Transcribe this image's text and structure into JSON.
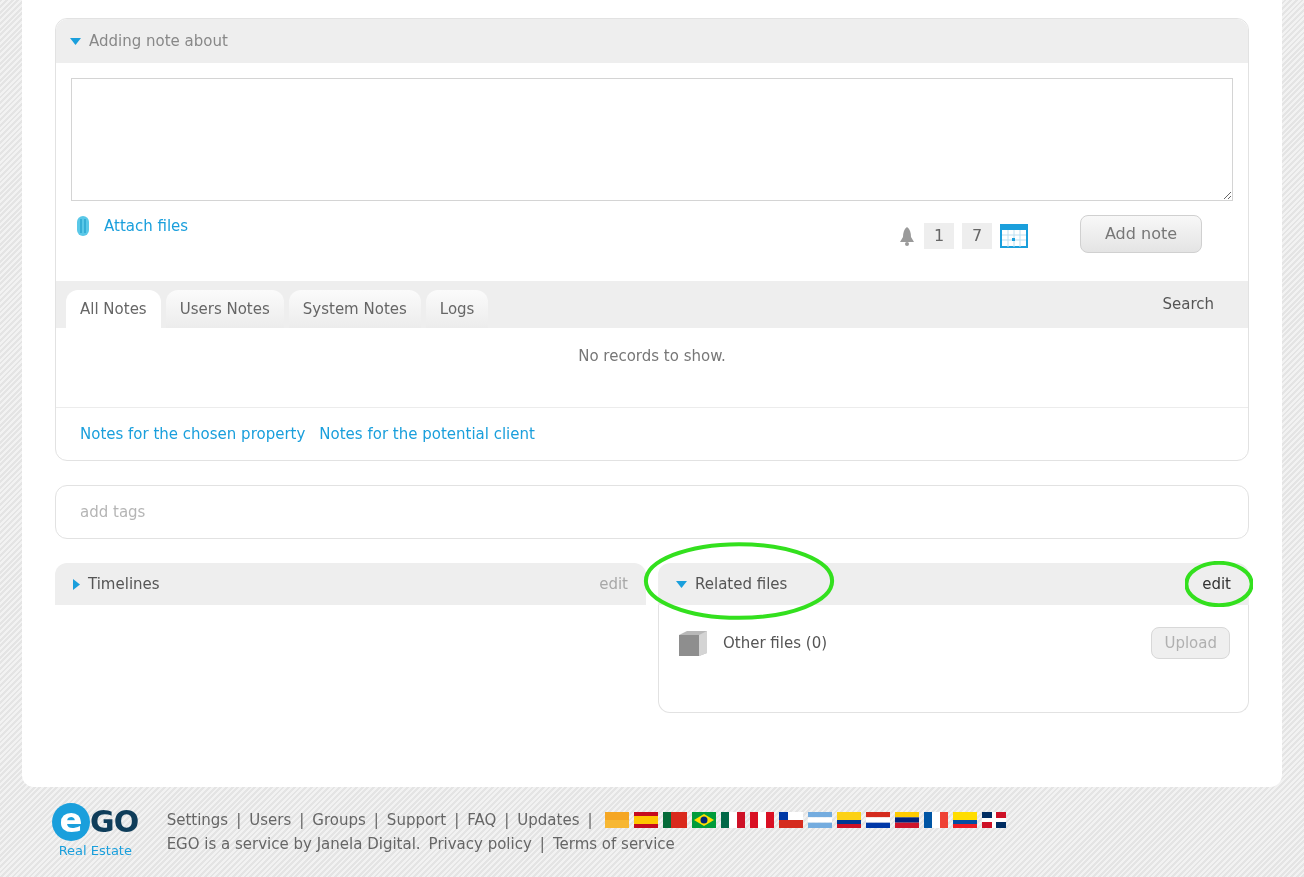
{
  "note_panel": {
    "title": "Adding note about",
    "expanded": true,
    "attach_label": "Attach files",
    "reminder": {
      "fields": [
        "1",
        "7"
      ]
    },
    "add_button": "Add note"
  },
  "tabs": [
    {
      "label": "All Notes",
      "selected": true
    },
    {
      "label": "Users Notes",
      "selected": false
    },
    {
      "label": "System Notes",
      "selected": false
    },
    {
      "label": "Logs",
      "selected": false
    }
  ],
  "search_label": "Search",
  "empty_message": "No records to show.",
  "filter_links": [
    "Notes for the chosen property",
    "Notes for the potential client"
  ],
  "tags_field": {
    "placeholder": "add tags"
  },
  "timelines": {
    "title": "Timelines",
    "expanded": false,
    "edit": {
      "label": "edit",
      "disabled": true
    }
  },
  "related_files": {
    "title": "Related files",
    "expanded": true,
    "edit": {
      "label": "edit",
      "disabled": false
    },
    "items": [
      {
        "label": "Other files (0)",
        "button": {
          "label": "Upload",
          "disabled": true
        }
      }
    ]
  },
  "footer": {
    "logo": {
      "mark": "e",
      "name": "GO",
      "tagline": "Real Estate"
    },
    "links": [
      "Settings",
      "Users",
      "Groups",
      "Support",
      "FAQ",
      "Updates"
    ],
    "separator": "|",
    "service_text": "EGO is a service by Janela Digital.",
    "legal_links": [
      "Privacy policy",
      "Terms of service"
    ]
  }
}
